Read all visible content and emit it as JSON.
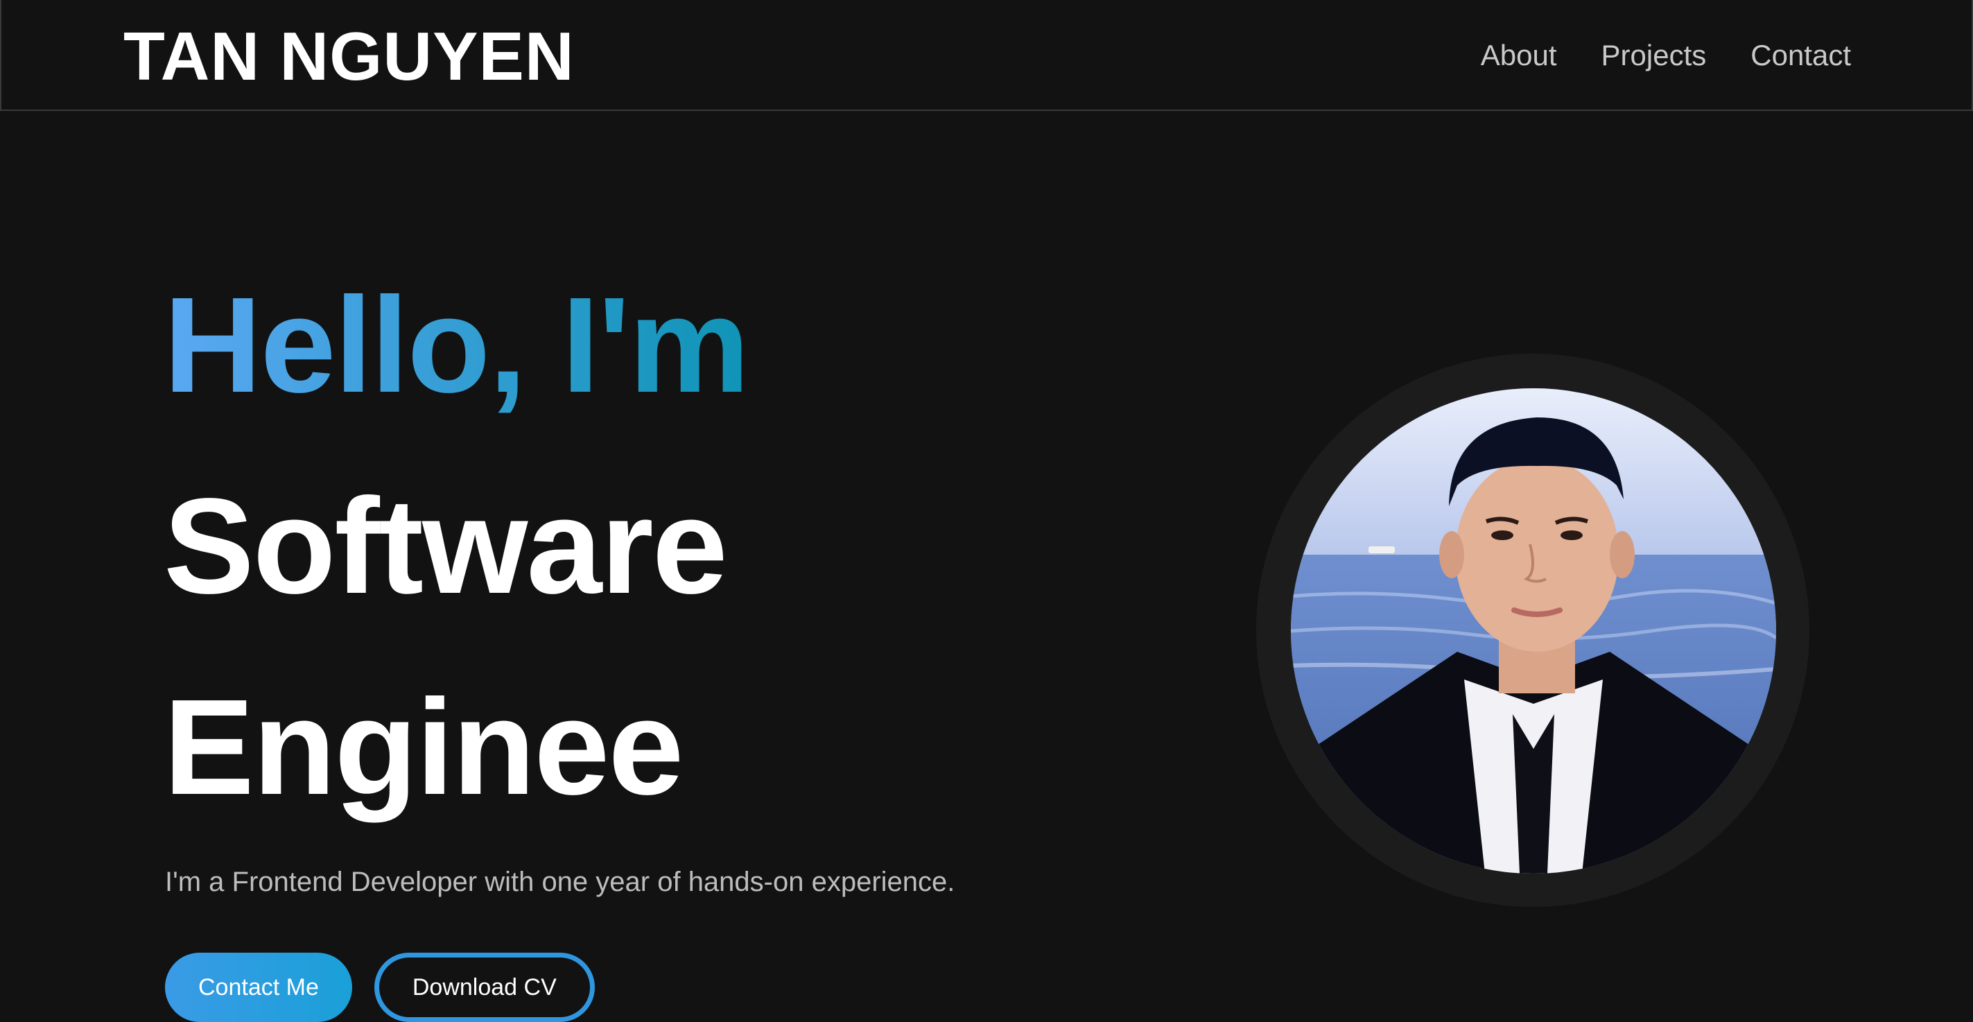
{
  "header": {
    "brand": "TAN NGUYEN",
    "nav": [
      {
        "label": "About"
      },
      {
        "label": "Projects"
      },
      {
        "label": "Contact"
      }
    ]
  },
  "hero": {
    "greeting": "Hello, I'm",
    "role_line_1": "Software",
    "role_line_2": "Enginee",
    "subtitle": "I'm a Frontend Developer with one year of hands-on experience.",
    "buttons": {
      "contact_label": "Contact Me",
      "download_label": "Download CV"
    }
  },
  "colors": {
    "background": "#121212",
    "accent_start": "#5aa8f2",
    "accent_end": "#0f94b6"
  }
}
